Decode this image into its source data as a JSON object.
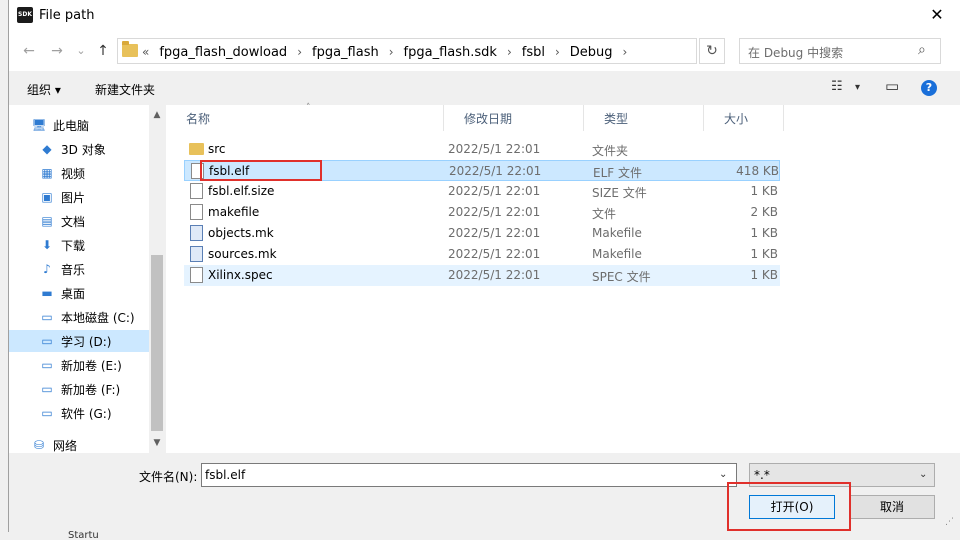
{
  "window": {
    "title": "File path",
    "app_icon_label": "SDK",
    "close_label": "✕"
  },
  "background_app": {
    "left_tabs": [
      "Startu"
    ]
  },
  "navbar": {
    "back": "←",
    "forward": "→",
    "recent": "⌄",
    "up": "↑",
    "breadcrumb_prefix": "«",
    "breadcrumbs": [
      "fpga_flash_dowload",
      "fpga_flash",
      "fpga_flash.sdk",
      "fsbl",
      "Debug"
    ],
    "crumb_sep": "›",
    "dropdown": "⌄",
    "refresh": "↻",
    "search_placeholder": "在 Debug 中搜索",
    "search_icon": "⌕"
  },
  "toolbar": {
    "organize": "组织 ▾",
    "new_folder": "新建文件夹",
    "view_icon": "☷",
    "view_drop": "▾",
    "pane_icon": "▭",
    "help": "?"
  },
  "sidebar": {
    "items": [
      {
        "label": "此电脑",
        "icon": "pc-icon",
        "glyph": "🖥"
      },
      {
        "label": "3D 对象",
        "icon": "3d-objects-icon",
        "glyph": "◆"
      },
      {
        "label": "视频",
        "icon": "video-icon",
        "glyph": "▦"
      },
      {
        "label": "图片",
        "icon": "pictures-icon",
        "glyph": "▣"
      },
      {
        "label": "文档",
        "icon": "documents-icon",
        "glyph": "▤"
      },
      {
        "label": "下载",
        "icon": "download-icon",
        "glyph": "⬇"
      },
      {
        "label": "音乐",
        "icon": "music-icon",
        "glyph": "♪"
      },
      {
        "label": "桌面",
        "icon": "desktop-icon",
        "glyph": "▬"
      },
      {
        "label": "本地磁盘 (C:)",
        "icon": "drive-c-icon",
        "glyph": "▭"
      },
      {
        "label": "学习 (D:)",
        "icon": "drive-icon",
        "glyph": "▭",
        "selected": true
      },
      {
        "label": "新加卷 (E:)",
        "icon": "drive-icon",
        "glyph": "▭"
      },
      {
        "label": "新加卷 (F:)",
        "icon": "drive-icon",
        "glyph": "▭"
      },
      {
        "label": "软件 (G:)",
        "icon": "drive-icon",
        "glyph": "▭"
      },
      {
        "label": "网络",
        "icon": "network-icon",
        "glyph": "⛁"
      }
    ],
    "scroll_up": "▲",
    "scroll_down": "▼"
  },
  "columns": {
    "name": "名称",
    "date": "修改日期",
    "type": "类型",
    "size": "大小",
    "sort_indicator": "˄"
  },
  "files": [
    {
      "name": "src",
      "date": "2022/5/1 22:01",
      "type": "文件夹",
      "size": "",
      "icon": "folder"
    },
    {
      "name": "fsbl.elf",
      "date": "2022/5/1 22:01",
      "type": "ELF 文件",
      "size": "418 KB",
      "icon": "doc",
      "state": "sel"
    },
    {
      "name": "fsbl.elf.size",
      "date": "2022/5/1 22:01",
      "type": "SIZE 文件",
      "size": "1 KB",
      "icon": "doc"
    },
    {
      "name": "makefile",
      "date": "2022/5/1 22:01",
      "type": "文件",
      "size": "2 KB",
      "icon": "doc"
    },
    {
      "name": "objects.mk",
      "date": "2022/5/1 22:01",
      "type": "Makefile",
      "size": "1 KB",
      "icon": "mk"
    },
    {
      "name": "sources.mk",
      "date": "2022/5/1 22:01",
      "type": "Makefile",
      "size": "1 KB",
      "icon": "mk"
    },
    {
      "name": "Xilinx.spec",
      "date": "2022/5/1 22:01",
      "type": "SPEC 文件",
      "size": "1 KB",
      "icon": "doc",
      "state": "hl"
    }
  ],
  "bottom": {
    "filename_label": "文件名(N):",
    "filename_value": "fsbl.elf",
    "filter_value": "*.*",
    "dropdown": "⌄",
    "open_button": "打开(O)",
    "cancel_button": "取消",
    "grip": "⋰"
  }
}
